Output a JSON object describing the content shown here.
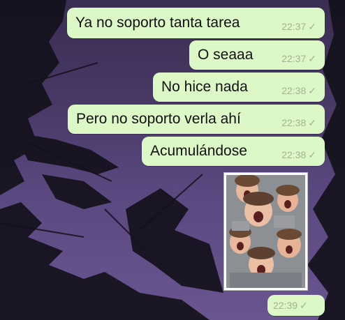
{
  "chat": {
    "messages": [
      {
        "text": "Ya no soporto tanta tarea",
        "time": "22:37",
        "status": "✓"
      },
      {
        "text": "O seaaa",
        "time": "22:37",
        "status": "✓"
      },
      {
        "text": "No hice nada",
        "time": "22:38",
        "status": "✓"
      },
      {
        "text": "Pero no soporto verla ahí",
        "time": "22:38",
        "status": "✓"
      },
      {
        "text": "Acumulándose",
        "time": "22:38",
        "status": "✓"
      }
    ],
    "sticker": {
      "icon": "screaming-child-sticker",
      "time": "22:39",
      "status": "✓"
    }
  },
  "colors": {
    "bubble": "#dcf8c6",
    "background": "#4a3a68",
    "time_text": "#9fb493"
  }
}
